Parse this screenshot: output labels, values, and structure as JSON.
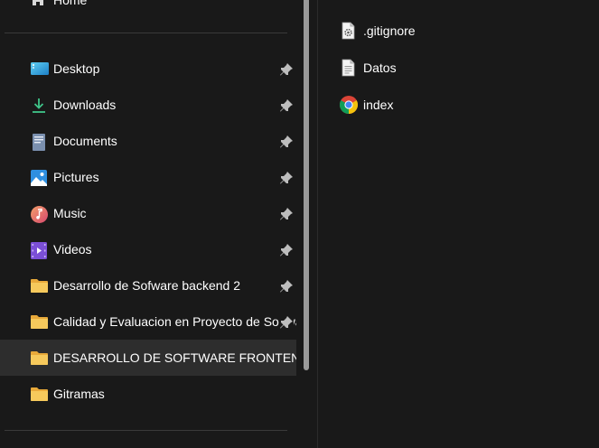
{
  "nav": {
    "home_label": "Home",
    "items": [
      {
        "label": "Desktop",
        "icon": "desktop-icon",
        "pinned": true
      },
      {
        "label": "Downloads",
        "icon": "download-icon",
        "pinned": true
      },
      {
        "label": "Documents",
        "icon": "documents-icon",
        "pinned": true
      },
      {
        "label": "Pictures",
        "icon": "pictures-icon",
        "pinned": true
      },
      {
        "label": "Music",
        "icon": "music-icon",
        "pinned": true
      },
      {
        "label": "Videos",
        "icon": "videos-icon",
        "pinned": true
      },
      {
        "label": "Desarrollo de Sofware backend 2",
        "icon": "folder-icon",
        "pinned": true
      },
      {
        "label": "Calidad y Evaluacion en Proyecto de Software",
        "icon": "folder-icon",
        "pinned": true
      },
      {
        "label": "DESARROLLO DE SOFTWARE FRONTEND",
        "icon": "folder-icon",
        "pinned": false,
        "selected": true
      },
      {
        "label": "Gitramas",
        "icon": "folder-icon",
        "pinned": false
      }
    ]
  },
  "content": {
    "files": [
      {
        "name": ".gitignore",
        "icon": "settings-file-icon"
      },
      {
        "name": "Datos",
        "icon": "text-file-icon"
      },
      {
        "name": "index",
        "icon": "chrome-icon"
      }
    ]
  },
  "colors": {
    "background": "#191919",
    "selected_row": "#2d2d2d",
    "folder": "#f2c35a",
    "text": "#ffffff"
  }
}
